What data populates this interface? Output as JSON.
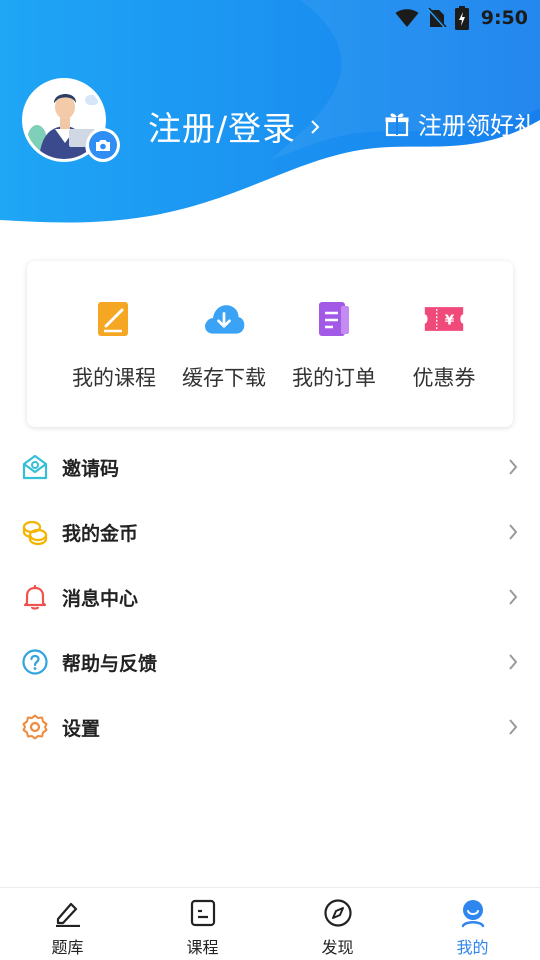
{
  "status_bar": {
    "time": "9:50"
  },
  "profile": {
    "login_label": "注册/登录",
    "gift_label": "注册领好礼"
  },
  "quick_actions": [
    {
      "label": "我的课程",
      "icon": "course-book-icon",
      "color": "#f5a623"
    },
    {
      "label": "缓存下载",
      "icon": "cloud-download-icon",
      "color": "#3aa3f5"
    },
    {
      "label": "我的订单",
      "icon": "order-document-icon",
      "color": "#a259e6"
    },
    {
      "label": "优惠券",
      "icon": "coupon-ticket-icon",
      "color": "#f04a7a"
    }
  ],
  "menu": [
    {
      "label": "邀请码",
      "icon": "invite-envelope-icon",
      "color": "#36c0d8"
    },
    {
      "label": "我的金币",
      "icon": "gold-coins-icon",
      "color": "#f4b400"
    },
    {
      "label": "消息中心",
      "icon": "bell-icon",
      "color": "#ef5350"
    },
    {
      "label": "帮助与反馈",
      "icon": "help-question-icon",
      "color": "#2fa4e0"
    },
    {
      "label": "设置",
      "icon": "settings-gear-icon",
      "color": "#f08a3c"
    }
  ],
  "tabs": [
    {
      "label": "题库",
      "icon": "pencil-icon",
      "active": false
    },
    {
      "label": "课程",
      "icon": "course-list-icon",
      "active": false
    },
    {
      "label": "发现",
      "icon": "compass-icon",
      "active": false
    },
    {
      "label": "我的",
      "icon": "user-icon",
      "active": true
    }
  ],
  "colors": {
    "header_blue": "#1a8cf0",
    "accent_blue": "#2f86ef"
  }
}
